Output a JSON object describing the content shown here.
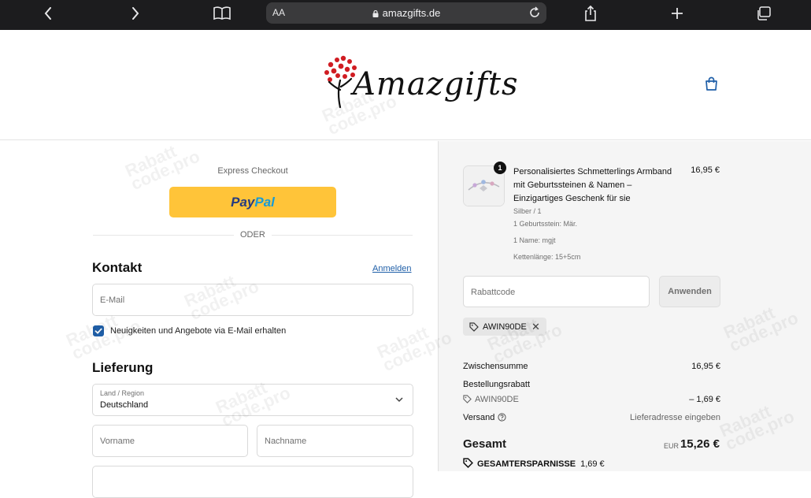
{
  "browser": {
    "text_size_label": "AA",
    "url": "amazgifts.de"
  },
  "store": {
    "name": "Amazgifts"
  },
  "checkout": {
    "express_label": "Express Checkout",
    "paypal_pay": "Pay",
    "paypal_pal": "Pal",
    "divider_label": "ODER",
    "contact": {
      "title": "Kontakt",
      "login_link": "Anmelden",
      "email_placeholder": "E-Mail",
      "newsletter_label": "Neuigkeiten und Angebote via E-Mail erhalten",
      "newsletter_checked": true
    },
    "delivery": {
      "title": "Lieferung",
      "country_label": "Land / Region",
      "country_value": "Deutschland",
      "first_name_placeholder": "Vorname",
      "last_name_placeholder": "Nachname"
    }
  },
  "summary": {
    "product": {
      "quantity": "1",
      "name": "Personalisiertes Schmetterlings Armband mit Geburtssteinen & Namen – Einzigartiges Geschenk für sie",
      "price": "16,95 €",
      "variant": "Silber / 1",
      "options": [
        "1 Geburtsstein: Mär.",
        "1 Name: mgjt",
        "Kettenlänge: 15+5cm"
      ]
    },
    "discount_placeholder": "Rabattcode",
    "apply_label": "Anwenden",
    "applied_code": "AWIN90DE",
    "subtotal_label": "Zwischensumme",
    "subtotal_value": "16,95 €",
    "order_discount_label": "Bestellungsrabatt",
    "order_discount_code": "AWIN90DE",
    "order_discount_value": "– 1,69 €",
    "shipping_label": "Versand",
    "shipping_value": "Lieferadresse eingeben",
    "total_label": "Gesamt",
    "currency": "EUR",
    "total_value": "15,26 €",
    "savings_label": "GESAMTERSPARNISSE",
    "savings_value": "1,69 €"
  },
  "watermark": {
    "line1": "Rabatt",
    "line2": "code.pro"
  },
  "colors": {
    "accent": "#1f5fa8",
    "paypal_yellow": "#ffc439",
    "logo_red": "#d01c22"
  }
}
